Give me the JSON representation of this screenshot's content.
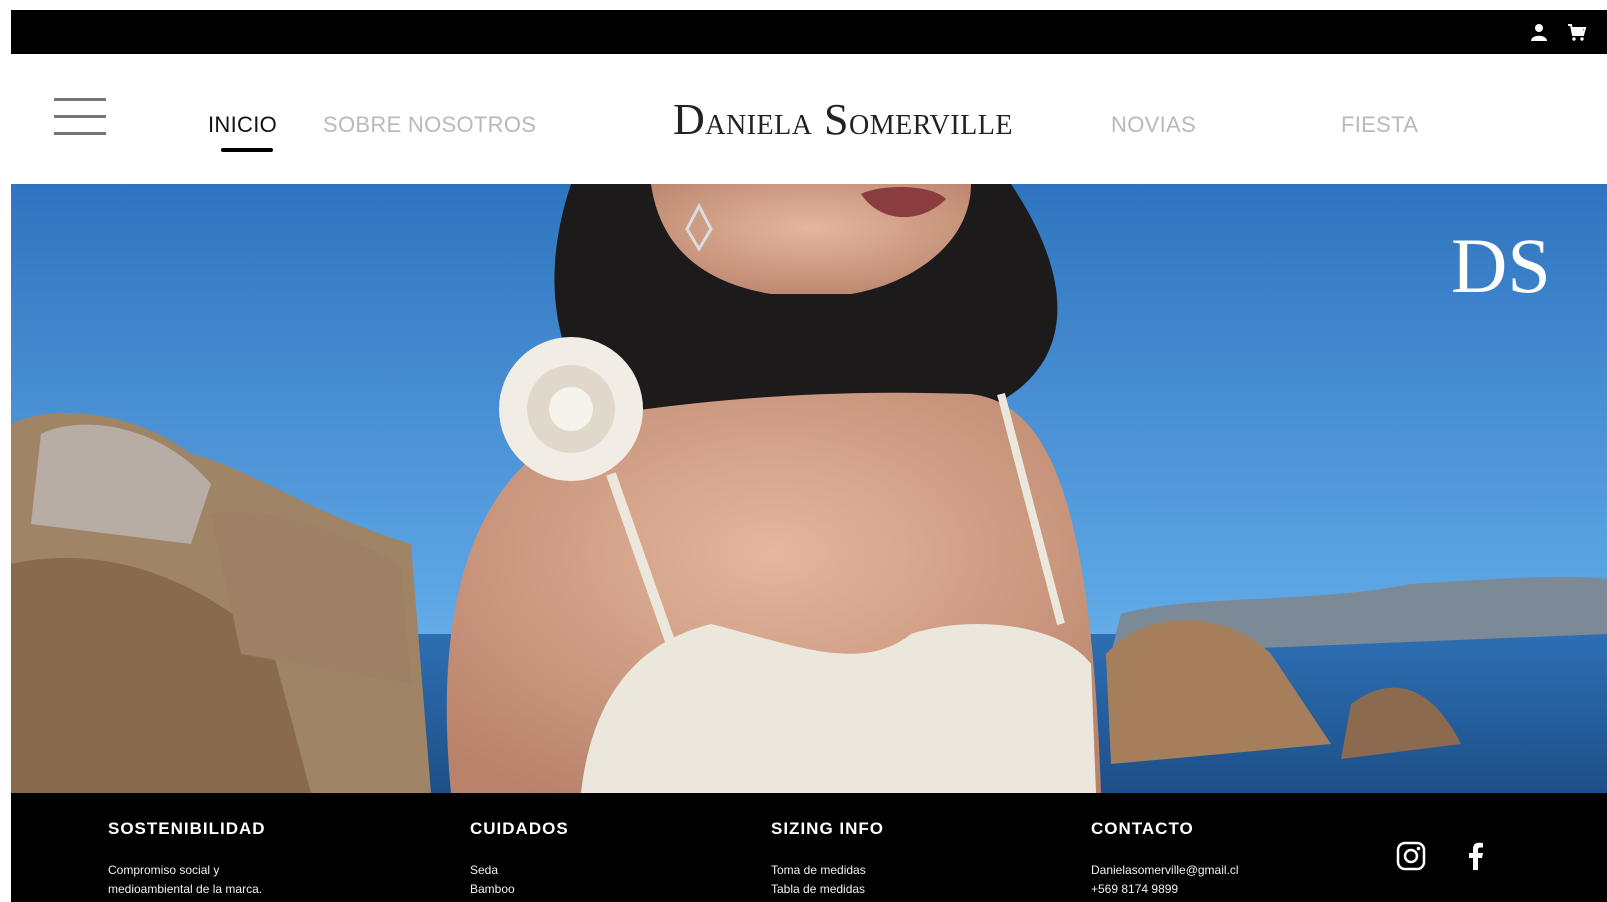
{
  "header": {
    "icons": [
      "user-icon",
      "cart-icon"
    ]
  },
  "nav": {
    "menu_icon": "hamburger-icon",
    "links": [
      {
        "label": "INICIO",
        "active": true
      },
      {
        "label": "SOBRE NOSOTROS",
        "active": false
      },
      {
        "label": "NOVIAS",
        "active": false
      },
      {
        "label": "FIESTA",
        "active": false
      }
    ]
  },
  "brand": {
    "logo_first_initial": "D",
    "logo_first_rest": "ANIELA",
    "logo_last_initial": "S",
    "logo_last_rest": "OMERVILLE",
    "monogram": "DS"
  },
  "footer": {
    "columns": [
      {
        "title": "SOSTENIBILIDAD",
        "lines": [
          "Compromiso social y",
          "medioambiental de la marca."
        ]
      },
      {
        "title": "CUIDADOS",
        "lines": [
          "Seda",
          "Bamboo"
        ]
      },
      {
        "title": "SIZING INFO",
        "lines": [
          "Toma de medidas",
          "Tabla de medidas"
        ]
      },
      {
        "title": "CONTACTO",
        "lines": [
          "Danielasomerville@gmail.cl",
          "+569 8174 9899"
        ]
      }
    ],
    "social": [
      "instagram-icon",
      "facebook-icon"
    ]
  },
  "colors": {
    "bar": "#000000",
    "nav_active": "#111111",
    "nav_muted": "#b9b9b9",
    "sky": "#3f86c9"
  }
}
